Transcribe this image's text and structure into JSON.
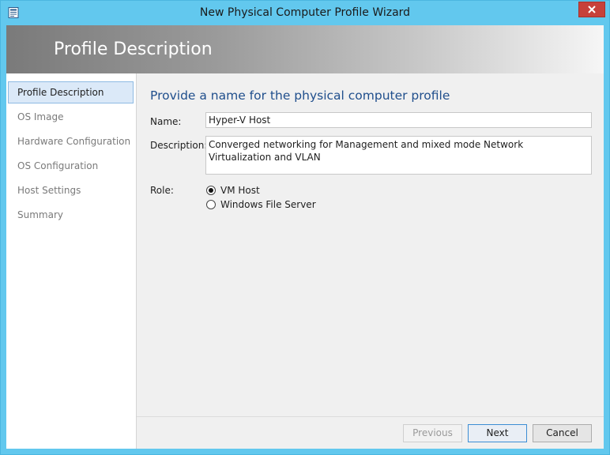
{
  "window": {
    "title": "New Physical Computer Profile Wizard"
  },
  "banner": {
    "title": "Profile Description"
  },
  "nav": {
    "items": [
      {
        "label": "Profile Description",
        "active": true
      },
      {
        "label": "OS Image",
        "active": false
      },
      {
        "label": "Hardware Configuration",
        "active": false
      },
      {
        "label": "OS Configuration",
        "active": false
      },
      {
        "label": "Host Settings",
        "active": false
      },
      {
        "label": "Summary",
        "active": false
      }
    ]
  },
  "form": {
    "heading": "Provide a name for the physical computer profile",
    "name_label": "Name:",
    "name_value": "Hyper-V Host",
    "description_label": "Description:",
    "description_value": "Converged networking for Management and mixed mode Network Virtualization and VLAN",
    "role_label": "Role:",
    "roles": [
      {
        "label": "VM Host",
        "selected": true
      },
      {
        "label": "Windows File Server",
        "selected": false
      }
    ]
  },
  "footer": {
    "previous_label": "Previous",
    "next_label": "Next",
    "cancel_label": "Cancel"
  },
  "colors": {
    "window_frame": "#62c8ee",
    "close_button": "#c7413a",
    "heading_text": "#1f4e8c",
    "nav_active_bg": "#dbe9f8",
    "content_bg": "#f0f0f0"
  },
  "icons": {
    "app": "wizard-window-icon",
    "close": "close-icon"
  }
}
